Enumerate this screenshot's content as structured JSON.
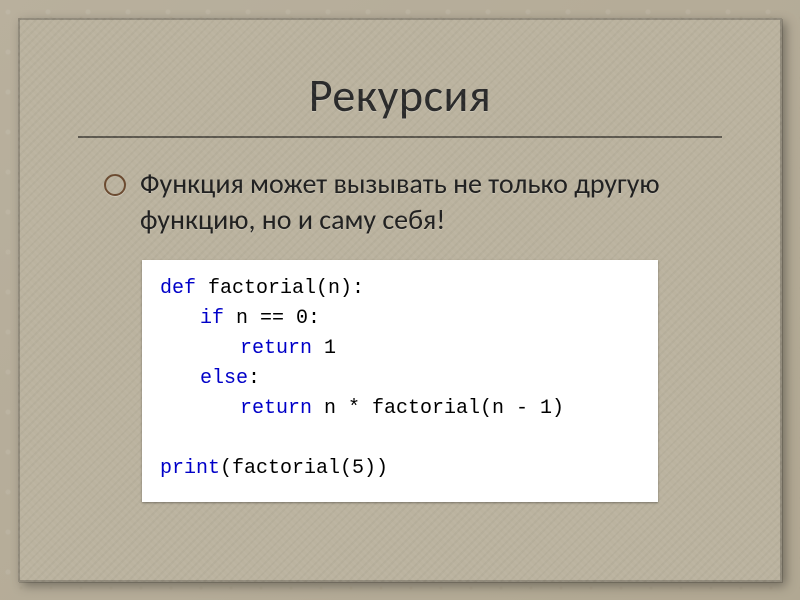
{
  "slide": {
    "title": "Рекурсия",
    "bullet": "Функция может вызывать не  только другую функцию, но  и саму себя!",
    "code": {
      "l1_kw": "def",
      "l1_rest": " factorial(n):",
      "l2_kw": "if",
      "l2_rest": " n == 0:",
      "l3_kw": "return",
      "l3_rest": " 1",
      "l4_kw": "else",
      "l4_rest": ":",
      "l5_kw": "return",
      "l5_rest": " n * factorial(n - 1)",
      "l6a_kw": "print",
      "l6a_rest": "(factorial(5))"
    }
  }
}
